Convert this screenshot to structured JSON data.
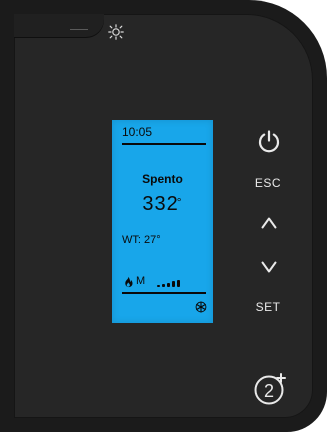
{
  "header": {
    "top_icon": "sun-icon"
  },
  "lcd": {
    "time": "10:05",
    "status": "Spento",
    "temperature": "332",
    "temperature_unit": "°",
    "water_temperature": "WT: 27°",
    "mode_letter": "M",
    "power_bars": {
      "filled": 5,
      "total": 5
    },
    "icons": {
      "flame": "flame-icon",
      "snowflake": "snowflake-icon"
    }
  },
  "controls": {
    "power": {
      "icon": "power-icon"
    },
    "esc_label": "ESC",
    "up": {
      "icon": "chevron-up-icon"
    },
    "down": {
      "icon": "chevron-down-icon"
    },
    "set_label": "SET",
    "extra": {
      "icon": "2plus-icon"
    }
  },
  "colors": {
    "panel": "#262626",
    "lcd": "#18a6ea",
    "text_on_panel": "#e9e9e9",
    "text_on_lcd": "#0a0a0a"
  }
}
